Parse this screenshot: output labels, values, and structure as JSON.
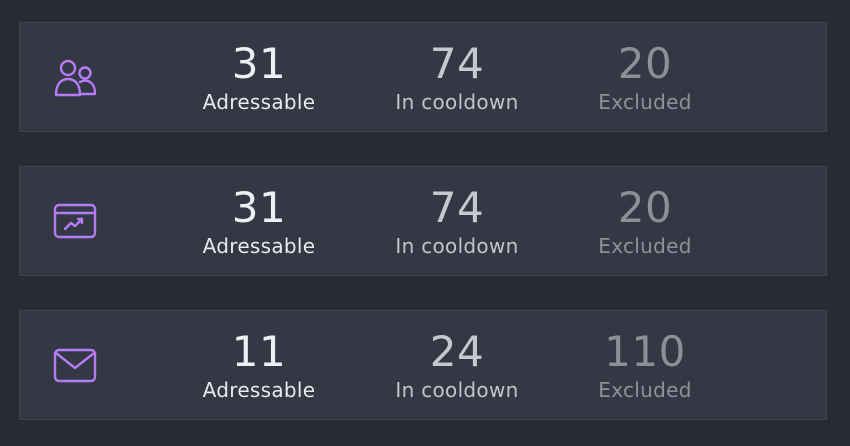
{
  "accent_color": "#b57cf6",
  "cards": [
    {
      "icon": "users-icon",
      "addressable": {
        "value": "31",
        "label": "Adressable"
      },
      "cooldown": {
        "value": "74",
        "label": "In cooldown"
      },
      "excluded": {
        "value": "20",
        "label": "Excluded"
      }
    },
    {
      "icon": "analytics-chart-icon",
      "addressable": {
        "value": "31",
        "label": "Adressable"
      },
      "cooldown": {
        "value": "74",
        "label": "In cooldown"
      },
      "excluded": {
        "value": "20",
        "label": "Excluded"
      }
    },
    {
      "icon": "envelope-icon",
      "addressable": {
        "value": "11",
        "label": "Adressable"
      },
      "cooldown": {
        "value": "24",
        "label": "In cooldown"
      },
      "excluded": {
        "value": "110",
        "label": "Excluded"
      }
    }
  ]
}
